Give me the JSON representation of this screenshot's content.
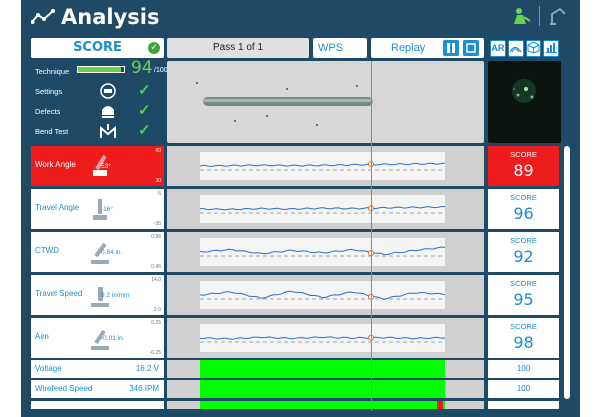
{
  "header": {
    "title": "Analysis"
  },
  "score_header": {
    "label": "SCORE"
  },
  "toolbar": {
    "pass_label": "Pass 1 of 1",
    "wps_label": "WPS",
    "replay_label": "Replay",
    "ar_label": "AR"
  },
  "summary": {
    "technique": {
      "label": "Technique",
      "value": "94",
      "denominator": "/100",
      "progress": 0.94
    },
    "rows": [
      {
        "label": "Settings"
      },
      {
        "label": "Defects"
      },
      {
        "label": "Bend Test"
      }
    ]
  },
  "params": [
    {
      "name": "Work Angle",
      "value": "53°",
      "hi": "60",
      "lo": "30",
      "score_label": "SCORE",
      "score": "89",
      "status": "bad"
    },
    {
      "name": "Travel Angle",
      "value": "-16°",
      "hi": "-5",
      "lo": "-35",
      "score_label": "SCORE",
      "score": "96",
      "status": "ok"
    },
    {
      "name": "CTWD",
      "value": "0.84 in.",
      "hi": "0.96",
      "lo": "0.46",
      "score_label": "SCORE",
      "score": "92",
      "status": "ok"
    },
    {
      "name": "Travel Speed",
      "value": "9.2 in/min",
      "hi": "14.0",
      "lo": "2.0",
      "score_label": "SCORE",
      "score": "95",
      "status": "ok"
    },
    {
      "name": "Aim",
      "value": "-0.01 in.",
      "hi": "0.25",
      "lo": "-0.25",
      "score_label": "SCORE",
      "score": "98",
      "status": "ok"
    }
  ],
  "machine": [
    {
      "name": "Voltage",
      "value": "16.2 V",
      "score": "100"
    },
    {
      "name": "Wirefeed Speed",
      "value": "346 IPM",
      "score": "100"
    }
  ],
  "colors": {
    "frame": "#1e4a67",
    "accent": "#1a8fcf",
    "bad": "#ee1c1c",
    "good": "#00ff00",
    "cursor": "#e0702a"
  }
}
